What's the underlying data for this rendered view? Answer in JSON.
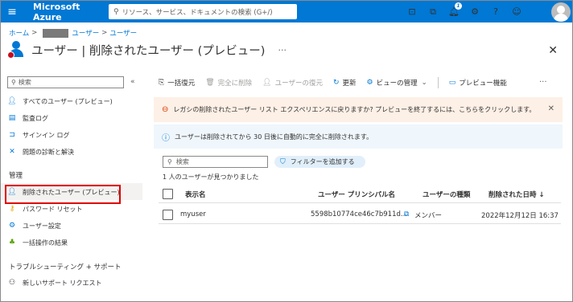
{
  "topbar": {
    "menu_icon": "≡",
    "brand": "Microsoft Azure",
    "search_placeholder": "リソース、サービス、ドキュメントの検索 (G+/)",
    "notification_count": "1"
  },
  "breadcrumb": {
    "home": "ホーム",
    "users1": "ユーザー",
    "users2": "ユーザー",
    "sep": ">"
  },
  "page": {
    "title": "ユーザー | 削除されたユーザー (プレビュー)",
    "more": "···",
    "close": "✕"
  },
  "sidebar": {
    "search_placeholder": "検索",
    "collapse": "«",
    "items": [
      {
        "label": "すべてのユーザー (プレビュー)"
      },
      {
        "label": "監査ログ"
      },
      {
        "label": "サインイン ログ"
      },
      {
        "label": "問題の診断と解決"
      }
    ],
    "section_manage": "管理",
    "manage_items": [
      {
        "label": "削除されたユーザー (プレビュー)"
      },
      {
        "label": "パスワード リセット"
      },
      {
        "label": "ユーザー設定"
      },
      {
        "label": "一括操作の結果"
      }
    ],
    "section_troubleshoot": "トラブルシューティング + サポート",
    "support_items": [
      {
        "label": "新しいサポート リクエスト"
      }
    ]
  },
  "toolbar": {
    "bulk_restore": "一括復元",
    "delete_permanently": "完全に削除",
    "restore_user": "ユーザーの復元",
    "refresh": "更新",
    "manage_view": "ビューの管理",
    "preview_features": "プレビュー機能",
    "more": "···"
  },
  "banners": {
    "warning": "レガシの削除されたユーザー リスト エクスペリエンスに戻りますか? プレビューを終了するには、こちらをクリックします。",
    "info": "ユーザーは削除されてから 30 日後に自動的に完全に削除されます。"
  },
  "filters": {
    "search_placeholder": "検索",
    "add_filter": "フィルターを追加する"
  },
  "result_count": "1 人のユーザーが見つかりました",
  "table": {
    "columns": [
      "表示名",
      "ユーザー プリンシパル名",
      "ユーザーの種類",
      "削除された日時 ↓"
    ],
    "rows": [
      {
        "display_name": "myuser",
        "upn": "5598b10774ce46c7b911d...",
        "user_type": "メンバー",
        "deleted_at": "2022年12月12日 16:37"
      }
    ]
  },
  "colors": {
    "accent": "#0078d4",
    "highlight_box": "#e00000",
    "warning_bg": "#fdf0e6",
    "info_bg": "#eff6fc"
  }
}
